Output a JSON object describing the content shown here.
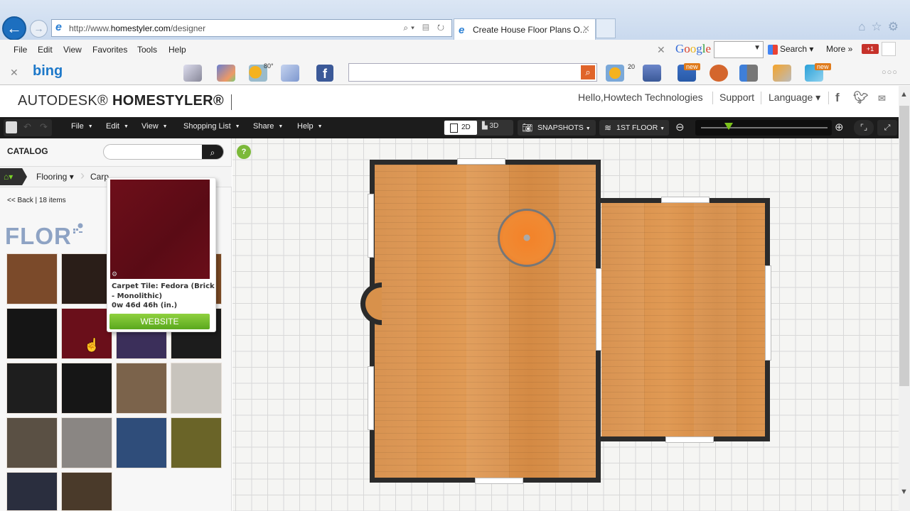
{
  "browser": {
    "url_prefix": "http://www.",
    "url_domain": "homestyler.com",
    "url_path": "/designer",
    "tab_title": "Create House Floor Plans O...",
    "menu": [
      "File",
      "Edit",
      "View",
      "Favorites",
      "Tools",
      "Help"
    ],
    "google": {
      "logo": "Google",
      "search_label": "Search",
      "more_label": "More »",
      "gplus_label": "+1"
    },
    "bing": {
      "logo": "bing",
      "weather": "80°",
      "badge_count": "20",
      "badge_new": "new",
      "search_placeholder": ""
    }
  },
  "header": {
    "brand_light": "AUTODESK®",
    "brand_bold": "HOMESTYLER®",
    "greeting": "Hello,Howtech Technologies",
    "support": "Support",
    "language": "Language ▾"
  },
  "toolbar": {
    "menus": [
      "File",
      "Edit",
      "View",
      "Shopping List",
      "Share",
      "Help"
    ],
    "view_2d": "2D",
    "view_3d": "3D",
    "snapshots": "SNAPSHOTS",
    "floor": "1ST FLOOR",
    "zoom_level": 0.22
  },
  "catalog": {
    "title": "CATALOG",
    "search_value": "",
    "breadcrumb": [
      "Flooring ▾",
      "Carp"
    ],
    "back_label": "<< Back",
    "item_count": "| 18 items",
    "brand_logo": "FLOR",
    "swatches": [
      {
        "name": "brown-carpet",
        "color": "#7b4a2a"
      },
      {
        "name": "dark-brown-carpet",
        "color": "#2a1e18"
      },
      {
        "name": "hidden-swatch-1",
        "color": "#7a4a22"
      },
      {
        "name": "hidden-swatch-2",
        "color": "#7b4a25"
      },
      {
        "name": "black-carpet",
        "color": "#151515"
      },
      {
        "name": "fedora-brick-carpet",
        "color": "#6a0f1a"
      },
      {
        "name": "purple-carpet",
        "color": "#3b2f5a"
      },
      {
        "name": "charcoal-carpet",
        "color": "#1c1c1c"
      },
      {
        "name": "black-textured-carpet",
        "color": "#1e1e1e"
      },
      {
        "name": "black-plain-carpet",
        "color": "#161616"
      },
      {
        "name": "taupe-carpet",
        "color": "#7b634b"
      },
      {
        "name": "zebra-carpet",
        "color": "#c8c4bd"
      },
      {
        "name": "plaid-carpet",
        "color": "#5a5044"
      },
      {
        "name": "floral-carpet",
        "color": "#8a8683"
      },
      {
        "name": "blue-carpet",
        "color": "#2f4d7a"
      },
      {
        "name": "olive-stripe-carpet",
        "color": "#6a6428"
      },
      {
        "name": "navy-stripe-carpet",
        "color": "#2a2e3e"
      },
      {
        "name": "beige-block-carpet",
        "color": "#4a3a2a"
      }
    ],
    "popup": {
      "name": "Carpet Tile: Fedora (Brick - Monolithic)",
      "dims": "0w 46d 46h (in.)",
      "button": "WEBSITE"
    }
  },
  "canvas": {
    "help_label": "?"
  }
}
